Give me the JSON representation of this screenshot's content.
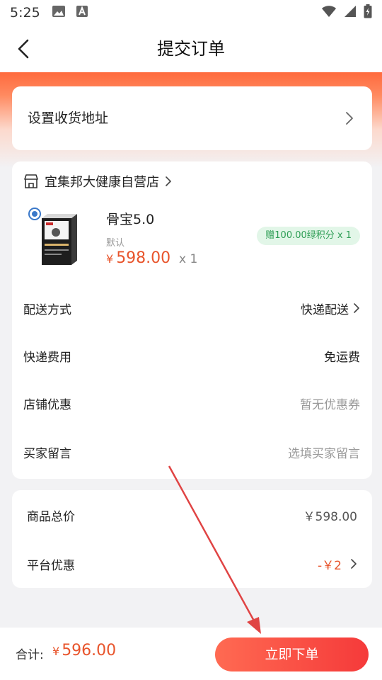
{
  "status_bar": {
    "time": "5:25",
    "left_icons": [
      "image-icon",
      "a-icon"
    ],
    "right_icons": [
      "wifi-icon",
      "signal-icon",
      "battery-icon"
    ]
  },
  "header": {
    "title": "提交订单",
    "back_icon": "back-arrow-icon"
  },
  "address": {
    "label": "设置收货地址",
    "chevron_icon": "chevron-right-icon"
  },
  "shop": {
    "name": "宜集邦大健康自营店",
    "shop_icon": "shop-icon"
  },
  "product": {
    "name": "骨宝5.0",
    "spec": "默认",
    "currency": "¥",
    "price": "598.00",
    "qty": "x 1",
    "gift": "赠100.00绿积分 x 1"
  },
  "order_rows": [
    {
      "key": "配送方式",
      "value": "快递配送"
    },
    {
      "key": "快递费用",
      "value": "免运费"
    },
    {
      "key": "店铺优惠",
      "value": "暂无优惠券"
    },
    {
      "key": "买家留言",
      "value": "选填买家留言"
    }
  ],
  "summary_rows": [
    {
      "key": "商品总价",
      "value": "￥598.00"
    },
    {
      "key": "平台优惠",
      "value": "-￥2"
    }
  ],
  "footer": {
    "total_label": "合计:",
    "currency": "¥",
    "total_value": "596.00",
    "submit_label": "立即下单"
  },
  "colors": {
    "accent": "#e8542b",
    "header_gradient_start": "#ff6a3d",
    "button_start": "#ff6a52",
    "button_end": "#f53a3a",
    "gift_bg": "#e2f6e8",
    "gift_text": "#2e9e55",
    "annotation": "#e04444"
  }
}
